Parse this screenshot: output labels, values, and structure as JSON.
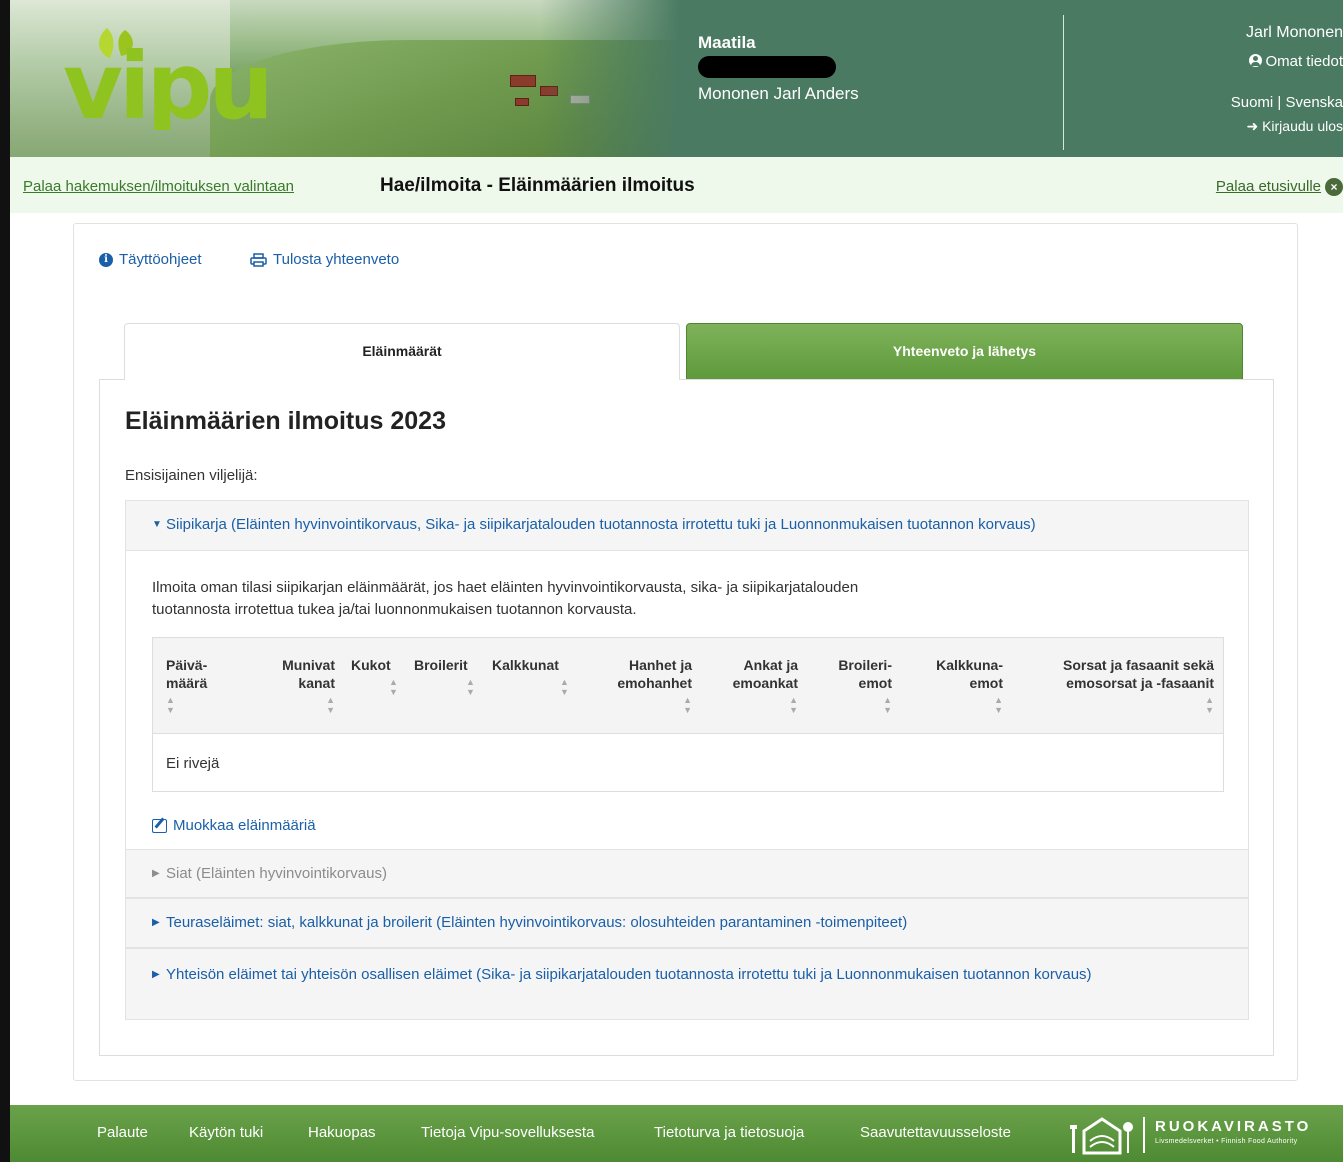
{
  "header": {
    "logo_text": "vipu",
    "farm_title": "Maatila",
    "farm_owner": "Mononen Jarl Anders",
    "user_name": "Jarl Mononen",
    "own_info": "Omat tiedot",
    "language": "Suomi | Svenska",
    "logout": "Kirjaudu ulos"
  },
  "subheader": {
    "back_link": "Palaa hakemuksen/ilmoituksen valintaan",
    "page_title": "Hae/ilmoita - Eläinmäärien ilmoitus",
    "home_link": "Palaa etusivulle"
  },
  "toolbar": {
    "instructions": "Täyttöohjeet",
    "print_summary": "Tulosta yhteenveto"
  },
  "tabs": [
    {
      "label": "Eläinmäärät",
      "active": true
    },
    {
      "label": "Yhteenveto ja lähetys",
      "active": false
    }
  ],
  "form": {
    "title": "Eläinmäärien ilmoitus 2023",
    "primary_farmer_label": "Ensisijainen viljelijä:"
  },
  "sections": [
    {
      "title": "Siipikarja (Eläinten hyvinvointikorvaus, Sika- ja siipikarjatalouden tuotannosta irrotettu tuki ja Luonnonmukaisen tuotannon korvaus)",
      "expanded": true,
      "description": "Ilmoita oman tilasi siipikarjan eläinmäärät, jos haet eläinten hyvinvointikorvausta, sika- ja siipikarjatalouden tuotannosta irrotettua tukea ja/tai luonnonmukaisen tuotannon korvausta.",
      "columns": [
        "Päivä-\nmäärä",
        "Munivat\nkanat",
        "Kukot",
        "Broilerit",
        "Kalkkunat",
        "Hanhet ja\nemohanhet",
        "Ankat ja\nemoankat",
        "Broileri-\nemot",
        "Kalkkuna-\nemot",
        "Sorsat ja fasaanit sekä\nemosorsat ja -fasaanit"
      ],
      "empty_text": "Ei rivejä",
      "edit_link": "Muokkaa eläinmääriä"
    },
    {
      "title": "Siat (Eläinten hyvinvointikorvaus)",
      "expanded": false,
      "disabled": true
    },
    {
      "title": "Teuraseläimet: siat, kalkkunat ja broilerit (Eläinten hyvinvointikorvaus: olosuhteiden parantaminen -toimenpiteet)",
      "expanded": false
    },
    {
      "title": "Yhteisön eläimet tai yhteisön osallisen eläimet (Sika- ja siipikarjatalouden tuotannosta irrotettu tuki ja Luonnonmukaisen tuotannon korvaus)",
      "expanded": false
    }
  ],
  "footer": {
    "links": [
      "Palaute",
      "Käytön tuki",
      "Hakuopas",
      "Tietoja Vipu-sovelluksesta",
      "Tietoturva ja tietosuoja",
      "Saavutettavuusseloste"
    ],
    "authority_name": "RUOKAVIRASTO",
    "authority_sub": "Livsmedelsverket • Finnish Food Authority"
  },
  "colors": {
    "header_green": "#4a7a62",
    "accent_green": "#5e9a3c",
    "link_blue": "#1a5fa8",
    "subheader_bg": "#eef9ec"
  },
  "icons": [
    "info-icon",
    "print-icon",
    "user-icon",
    "logout-icon",
    "close-icon",
    "caret-down-icon",
    "caret-right-icon",
    "sort-icon",
    "edit-icon",
    "ruokavirasto-logo"
  ]
}
